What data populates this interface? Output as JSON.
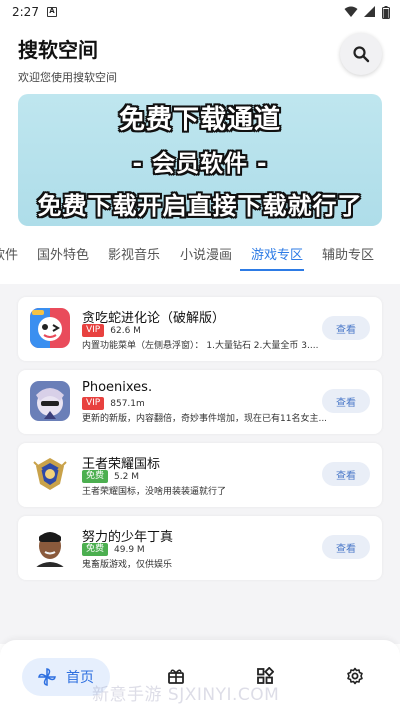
{
  "status": {
    "time": "2:27",
    "a_label": "A"
  },
  "header": {
    "title": "搜软空间",
    "subtitle": "欢迎您使用搜软空间"
  },
  "banner": {
    "line1": "免费下载通道",
    "line2": "- 会员软件 -",
    "line3": "免费下载开启直接下载就行了"
  },
  "tabs": [
    {
      "label": "软件"
    },
    {
      "label": "国外特色"
    },
    {
      "label": "影视音乐"
    },
    {
      "label": "小说漫画"
    },
    {
      "label": "游戏专区",
      "active": true
    },
    {
      "label": "辅助专区"
    }
  ],
  "apps": [
    {
      "title": "贪吃蛇进化论（破解版）",
      "badge": "VIP",
      "size": "62.6 M",
      "desc": "内置功能菜单（左侧悬浮窗）： 1.大量钻石 2.大量全币  3....",
      "button": "查看"
    },
    {
      "title": "Phoenixes.",
      "badge": "VIP",
      "size": "857.1m",
      "desc": "更新的新版，内容翻倍，奇妙事件增加，现在已有11名女主...",
      "button": "查看"
    },
    {
      "title": "王者荣耀国标",
      "badge": "免费",
      "size": "5.2 M",
      "desc": "王者荣耀国标，没啥用装装逼就行了",
      "button": "查看"
    },
    {
      "title": "努力的少年丁真",
      "badge": "免费",
      "size": "49.9 M",
      "desc": "鬼畜版游戏，仅供娱乐",
      "button": "查看"
    }
  ],
  "nav": {
    "home": "首页"
  },
  "watermark": "新意手游  SJXINYI.COM",
  "colors": {
    "accent": "#2d7be5",
    "vip": "#e8413f",
    "free": "#4caf50",
    "banner_bg": "#aedde9"
  }
}
